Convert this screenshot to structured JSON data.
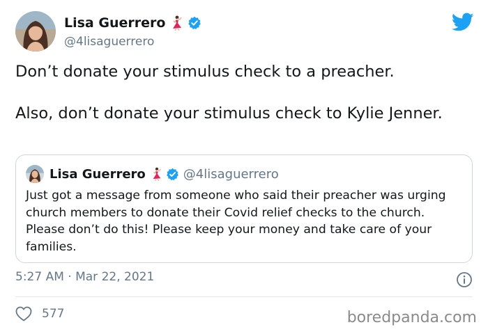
{
  "author": {
    "display_name": "Lisa Guerrero",
    "handle": "@4lisaguerrero",
    "emoji": "dancer-emoji",
    "verified": "verified-badge-icon"
  },
  "tweet": {
    "text_line1": "Don’t donate your stimulus check to a preacher.",
    "text_line2": "Also, don’t donate your stimulus check to Kylie Jenner.",
    "timestamp": "5:27 AM · Mar 22, 2021",
    "like_count": "577"
  },
  "quoted_tweet": {
    "display_name": "Lisa Guerrero",
    "handle": "@4lisaguerrero",
    "text": "Just got a message from someone who said their preacher was urging church members to donate their Covid relief checks to the church. Please don’t do this! Please keep your money and take care of your families."
  },
  "watermark": "boredpanda.com",
  "colors": {
    "twitter_blue": "#1da1f2",
    "secondary_text": "#657786",
    "border": "#ccd6dd",
    "dancer_red": "#e0245e"
  },
  "icons": [
    "twitter-logo-icon",
    "verified-badge-icon",
    "dancer-emoji",
    "info-icon",
    "heart-icon"
  ]
}
